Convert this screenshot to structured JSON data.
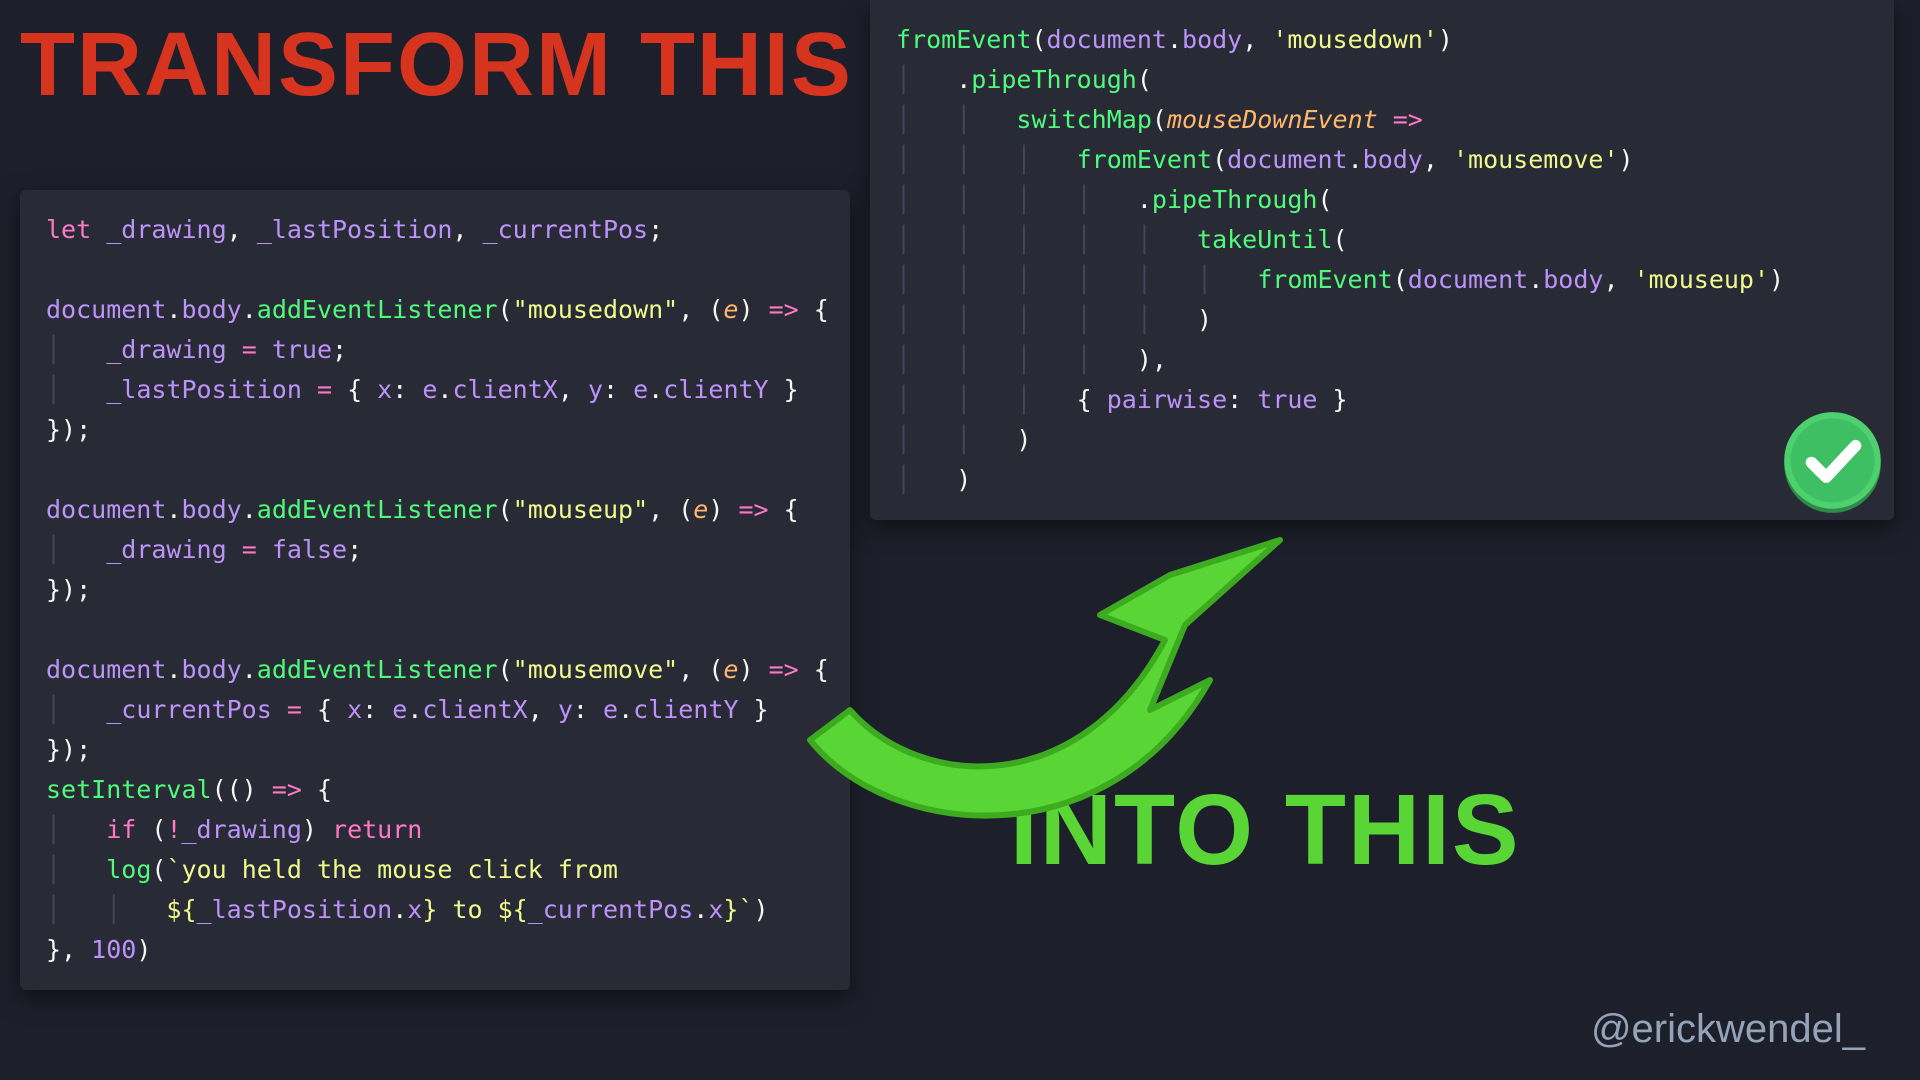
{
  "headings": {
    "left": "TRANSFORM THIS",
    "right": "INTO THIS"
  },
  "handle": "@erickwendel_",
  "colors": {
    "bg": "#1d1f2b",
    "panel": "#282a36",
    "headingLeft": "#d6341f",
    "headingRight": "#59d636",
    "arrow": "#59d636",
    "check": "#3fbf63"
  },
  "codeLeft": {
    "tokens": [
      [
        [
          "kw",
          "let"
        ],
        [
          "pun",
          " "
        ],
        [
          "var",
          "_drawing"
        ],
        [
          "pun",
          ", "
        ],
        [
          "var",
          "_lastPosition"
        ],
        [
          "pun",
          ", "
        ],
        [
          "var",
          "_currentPos"
        ],
        [
          "pun",
          ";"
        ]
      ],
      [],
      [
        [
          "var",
          "document"
        ],
        [
          "pun",
          "."
        ],
        [
          "var",
          "body"
        ],
        [
          "pun",
          "."
        ],
        [
          "fn",
          "addEventListener"
        ],
        [
          "pun",
          "("
        ],
        [
          "str",
          "\"mousedown\""
        ],
        [
          "pun",
          ", ("
        ],
        [
          "param",
          "e"
        ],
        [
          "pun",
          ") "
        ],
        [
          "kw",
          "=>"
        ],
        [
          "pun",
          " {"
        ]
      ],
      [
        [
          "guide",
          "│   "
        ],
        [
          "var",
          "_drawing"
        ],
        [
          "pun",
          " "
        ],
        [
          "op",
          "="
        ],
        [
          "pun",
          " "
        ],
        [
          "bool",
          "true"
        ],
        [
          "pun",
          ";"
        ]
      ],
      [
        [
          "guide",
          "│   "
        ],
        [
          "var",
          "_lastPosition"
        ],
        [
          "pun",
          " "
        ],
        [
          "op",
          "="
        ],
        [
          "pun",
          " { "
        ],
        [
          "var",
          "x"
        ],
        [
          "pun",
          ": "
        ],
        [
          "var",
          "e"
        ],
        [
          "pun",
          "."
        ],
        [
          "var",
          "clientX"
        ],
        [
          "pun",
          ", "
        ],
        [
          "var",
          "y"
        ],
        [
          "pun",
          ": "
        ],
        [
          "var",
          "e"
        ],
        [
          "pun",
          "."
        ],
        [
          "var",
          "clientY"
        ],
        [
          "pun",
          " }"
        ]
      ],
      [
        [
          "pun",
          "});"
        ]
      ],
      [],
      [
        [
          "var",
          "document"
        ],
        [
          "pun",
          "."
        ],
        [
          "var",
          "body"
        ],
        [
          "pun",
          "."
        ],
        [
          "fn",
          "addEventListener"
        ],
        [
          "pun",
          "("
        ],
        [
          "str",
          "\"mouseup\""
        ],
        [
          "pun",
          ", ("
        ],
        [
          "param",
          "e"
        ],
        [
          "pun",
          ") "
        ],
        [
          "kw",
          "=>"
        ],
        [
          "pun",
          " {"
        ]
      ],
      [
        [
          "guide",
          "│   "
        ],
        [
          "var",
          "_drawing"
        ],
        [
          "pun",
          " "
        ],
        [
          "op",
          "="
        ],
        [
          "pun",
          " "
        ],
        [
          "bool",
          "false"
        ],
        [
          "pun",
          ";"
        ]
      ],
      [
        [
          "pun",
          "});"
        ]
      ],
      [],
      [
        [
          "var",
          "document"
        ],
        [
          "pun",
          "."
        ],
        [
          "var",
          "body"
        ],
        [
          "pun",
          "."
        ],
        [
          "fn",
          "addEventListener"
        ],
        [
          "pun",
          "("
        ],
        [
          "str",
          "\"mousemove\""
        ],
        [
          "pun",
          ", ("
        ],
        [
          "param",
          "e"
        ],
        [
          "pun",
          ") "
        ],
        [
          "kw",
          "=>"
        ],
        [
          "pun",
          " {"
        ]
      ],
      [
        [
          "guide",
          "│   "
        ],
        [
          "var",
          "_currentPos"
        ],
        [
          "pun",
          " "
        ],
        [
          "op",
          "="
        ],
        [
          "pun",
          " { "
        ],
        [
          "var",
          "x"
        ],
        [
          "pun",
          ": "
        ],
        [
          "var",
          "e"
        ],
        [
          "pun",
          "."
        ],
        [
          "var",
          "clientX"
        ],
        [
          "pun",
          ", "
        ],
        [
          "var",
          "y"
        ],
        [
          "pun",
          ": "
        ],
        [
          "var",
          "e"
        ],
        [
          "pun",
          "."
        ],
        [
          "var",
          "clientY"
        ],
        [
          "pun",
          " }"
        ]
      ],
      [
        [
          "pun",
          "});"
        ]
      ],
      [
        [
          "fn",
          "setInterval"
        ],
        [
          "pun",
          "(() "
        ],
        [
          "kw",
          "=>"
        ],
        [
          "pun",
          " {"
        ]
      ],
      [
        [
          "guide",
          "│   "
        ],
        [
          "kw",
          "if"
        ],
        [
          "pun",
          " ("
        ],
        [
          "op",
          "!"
        ],
        [
          "var",
          "_drawing"
        ],
        [
          "pun",
          ") "
        ],
        [
          "kw",
          "return"
        ]
      ],
      [
        [
          "guide",
          "│   "
        ],
        [
          "fn",
          "log"
        ],
        [
          "pun",
          "("
        ],
        [
          "str",
          "`you held the mouse click from"
        ]
      ],
      [
        [
          "guide",
          "│   │   "
        ],
        [
          "str",
          "${"
        ],
        [
          "var",
          "_lastPosition"
        ],
        [
          "pun",
          "."
        ],
        [
          "var",
          "x"
        ],
        [
          "str",
          "} to ${"
        ],
        [
          "var",
          "_currentPos"
        ],
        [
          "pun",
          "."
        ],
        [
          "var",
          "x"
        ],
        [
          "str",
          "}`"
        ],
        [
          "pun",
          ")"
        ]
      ],
      [
        [
          "pun",
          "}, "
        ],
        [
          "num",
          "100"
        ],
        [
          "pun",
          ")"
        ]
      ]
    ]
  },
  "codeRight": {
    "tokens": [
      [
        [
          "fn",
          "fromEvent"
        ],
        [
          "pun",
          "("
        ],
        [
          "var",
          "document"
        ],
        [
          "pun",
          "."
        ],
        [
          "var",
          "body"
        ],
        [
          "pun",
          ", "
        ],
        [
          "str",
          "'mousedown'"
        ],
        [
          "pun",
          ")"
        ]
      ],
      [
        [
          "guide",
          "│   "
        ],
        [
          "pun",
          "."
        ],
        [
          "fn",
          "pipeThrough"
        ],
        [
          "pun",
          "("
        ]
      ],
      [
        [
          "guide",
          "│   │   "
        ],
        [
          "fn",
          "switchMap"
        ],
        [
          "pun",
          "("
        ],
        [
          "param",
          "mouseDownEvent"
        ],
        [
          "pun",
          " "
        ],
        [
          "kw",
          "=>"
        ]
      ],
      [
        [
          "guide",
          "│   │   │   "
        ],
        [
          "fn",
          "fromEvent"
        ],
        [
          "pun",
          "("
        ],
        [
          "var",
          "document"
        ],
        [
          "pun",
          "."
        ],
        [
          "var",
          "body"
        ],
        [
          "pun",
          ", "
        ],
        [
          "str",
          "'mousemove'"
        ],
        [
          "pun",
          ")"
        ]
      ],
      [
        [
          "guide",
          "│   │   │   │   "
        ],
        [
          "pun",
          "."
        ],
        [
          "fn",
          "pipeThrough"
        ],
        [
          "pun",
          "("
        ]
      ],
      [
        [
          "guide",
          "│   │   │   │   │   "
        ],
        [
          "fn",
          "takeUntil"
        ],
        [
          "pun",
          "("
        ]
      ],
      [
        [
          "guide",
          "│   │   │   │   │   │   "
        ],
        [
          "fn",
          "fromEvent"
        ],
        [
          "pun",
          "("
        ],
        [
          "var",
          "document"
        ],
        [
          "pun",
          "."
        ],
        [
          "var",
          "body"
        ],
        [
          "pun",
          ", "
        ],
        [
          "str",
          "'mouseup'"
        ],
        [
          "pun",
          ")"
        ]
      ],
      [
        [
          "guide",
          "│   │   │   │   │   "
        ],
        [
          "pun",
          ")"
        ]
      ],
      [
        [
          "guide",
          "│   │   │   │   "
        ],
        [
          "pun",
          "),"
        ]
      ],
      [
        [
          "guide",
          "│   │   │   "
        ],
        [
          "pun",
          "{ "
        ],
        [
          "var",
          "pairwise"
        ],
        [
          "pun",
          ": "
        ],
        [
          "bool",
          "true"
        ],
        [
          "pun",
          " }"
        ]
      ],
      [
        [
          "guide",
          "│   │   "
        ],
        [
          "pun",
          ")"
        ]
      ],
      [
        [
          "guide",
          "│   "
        ],
        [
          "pun",
          ")"
        ]
      ]
    ]
  }
}
